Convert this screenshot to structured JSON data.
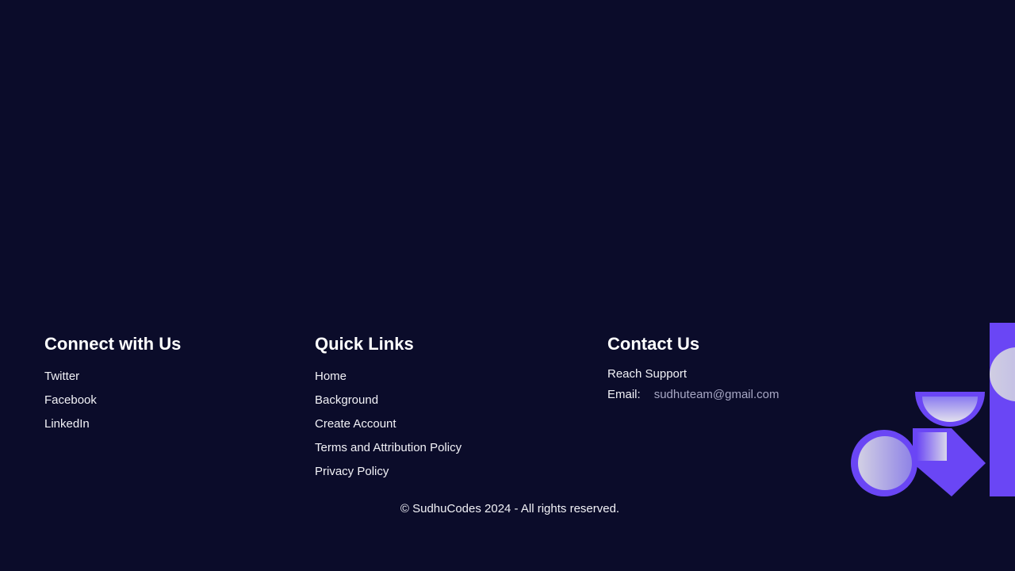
{
  "connect": {
    "title": "Connect with Us",
    "links": [
      "Twitter",
      "Facebook",
      "LinkedIn"
    ]
  },
  "quick_links": {
    "title": "Quick Links",
    "links": [
      "Home",
      "Background",
      "Create Account",
      "Terms and Attribution Policy",
      "Privacy Policy"
    ]
  },
  "contact": {
    "title": "Contact Us",
    "support": "Reach Support",
    "email_label": "Email:",
    "email": "sudhuteam@gmail.com"
  },
  "copyright": "© SudhuCodes 2024 - All rights reserved.",
  "colors": {
    "background": "#0b0c2a",
    "accent": "#6a46f5",
    "muted_text": "#a7a7c4"
  }
}
